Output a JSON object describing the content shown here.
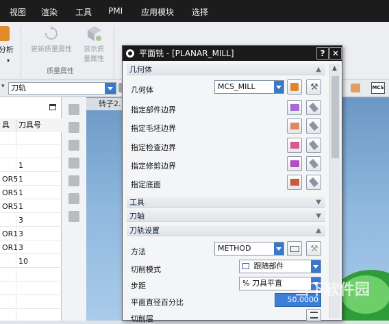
{
  "menubar": {
    "items": [
      "视图",
      "渲染",
      "工具",
      "PMI",
      "应用模块",
      "选择"
    ]
  },
  "ribbon": {
    "left_partial_label": "分析",
    "update_quality_label": "更新质量属性",
    "show_quality_label_1": "显示质",
    "show_quality_label_2": "量属性",
    "group_label": "质量属性"
  },
  "toolrow": {
    "combo_value": "刀轨",
    "mcs_label": "MCS"
  },
  "navigator": {
    "col1_header": "具",
    "col2_header": "刀具号",
    "rows": [
      {
        "c1": "",
        "c2": ""
      },
      {
        "c1": "",
        "c2": ""
      },
      {
        "c1": "",
        "c2": "1"
      },
      {
        "c1": "OR5",
        "c2": "1"
      },
      {
        "c1": "OR5",
        "c2": "1"
      },
      {
        "c1": "OR5",
        "c2": "1"
      },
      {
        "c1": "",
        "c2": "3"
      },
      {
        "c1": "OR1",
        "c2": "3"
      },
      {
        "c1": "OR1",
        "c2": "3"
      },
      {
        "c1": "",
        "c2": "10"
      },
      {
        "c1": "",
        "c2": ""
      },
      {
        "c1": "",
        "c2": ""
      },
      {
        "c1": "",
        "c2": ""
      },
      {
        "c1": "",
        "c2": ""
      }
    ]
  },
  "doc_tab": "转子2.",
  "dialog": {
    "title": "平面铣 - [PLANAR_MILL]",
    "help": "?",
    "close": "✕",
    "sections": {
      "geometry": "几何体",
      "tool": "工具",
      "axis": "刀轴",
      "path": "刀轨设置"
    },
    "geometry": {
      "label": "几何体",
      "value": "MCS_MILL",
      "part_boundary": "指定部件边界",
      "blank_boundary": "指定毛坯边界",
      "check_boundary": "指定检查边界",
      "trim_boundary": "指定修剪边界",
      "floor": "指定底面"
    },
    "path": {
      "method_label": "方法",
      "method_value": "METHOD",
      "cut_mode_label": "切削模式",
      "cut_mode_value": "跟随部件",
      "stepover_label": "步距",
      "stepover_value": "% 刀具平直",
      "percent_label": "平面直径百分比",
      "percent_value": "50.0000",
      "levels_label": "切削层"
    }
  },
  "watermark": "当下软件园",
  "colors": {
    "menubar": "#1c1c1c",
    "accent": "#3a78c9",
    "graphics_bg": "#8fb8de"
  }
}
